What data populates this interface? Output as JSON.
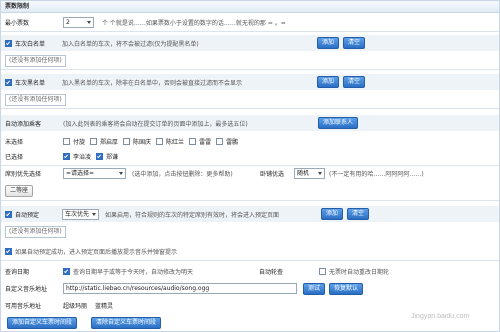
{
  "header": {
    "title": "票数限制"
  },
  "min_votes": {
    "label": "最小票数",
    "value": "2",
    "hint": "个 个就是说……如果票数小于设置的数字的话……就无视的那 = 。="
  },
  "whitelist": {
    "label": "车次白名单",
    "desc": "加入白名单的车次，将不会被过滤(仅为提配黑名单)",
    "add": "添加",
    "clear": "清空",
    "empty_hint": "(还没有添加任何项)"
  },
  "blacklist": {
    "label": "车次黑名单",
    "desc": "加入黑名单的车次，除非在白名单中，否则会被直接过滤而不会显示",
    "add": "添加",
    "clear": "清空",
    "empty_hint": "(还没有添加任何项)"
  },
  "auto_passenger": {
    "label": "自动添加乘客",
    "desc": "(加入此列表的乘客将会自动在提交订单的页面中添加上，最多选五位)",
    "add_button": "添加联系人"
  },
  "unselected": {
    "label": "未选择",
    "names": [
      "付旋",
      "郑启厚",
      "陈国庆",
      "陈红兰",
      "雷雷",
      "雷鹏"
    ]
  },
  "selected": {
    "label": "已选择",
    "names": [
      "李治凌",
      "郑谦"
    ]
  },
  "seat_priority": {
    "label": "席别优先选择",
    "value": "=请选择=",
    "hint": "(选中添加，点击按钮删除：更多帮助)",
    "sleeper_label": "卧铺优选",
    "sleeper_value": "随机",
    "sleeper_hint": "(不一定有用的哈……阿阿阿阿……)",
    "second_class": "二等座"
  },
  "auto_book": {
    "label": "自动预定",
    "value": "车次优先",
    "desc": "如果启用，符合规则的车次的特定席别有效时，将会进入预定页面",
    "add": "添加",
    "clear": "清空",
    "empty_hint": "(还没有添加任何项)",
    "notice": "如果自动预定成功，进入预定页面后播放提示音乐并弹窗提示"
  },
  "query_date": {
    "label": "查询日期",
    "desc": "查询日期早于或等于今天时，自动修改为明天",
    "auto_check_label": "自动轮查",
    "auto_check_desc": "无票时自动重改日期轮"
  },
  "music": {
    "label": "自定义音乐地址",
    "url": "http://static.liebao.cn/resources/audio/song.ogg",
    "test": "测试",
    "reset": "恢复默认"
  },
  "available_music": {
    "label": "可用音乐地址",
    "items": [
      "超级玛丽",
      "蓝精灵"
    ]
  },
  "footer": {
    "add_period": "添加自定义车票时间段",
    "clear_period": "清除自定义车票时间段"
  },
  "watermark": {
    "text": "Jingyan.baidu.com"
  }
}
